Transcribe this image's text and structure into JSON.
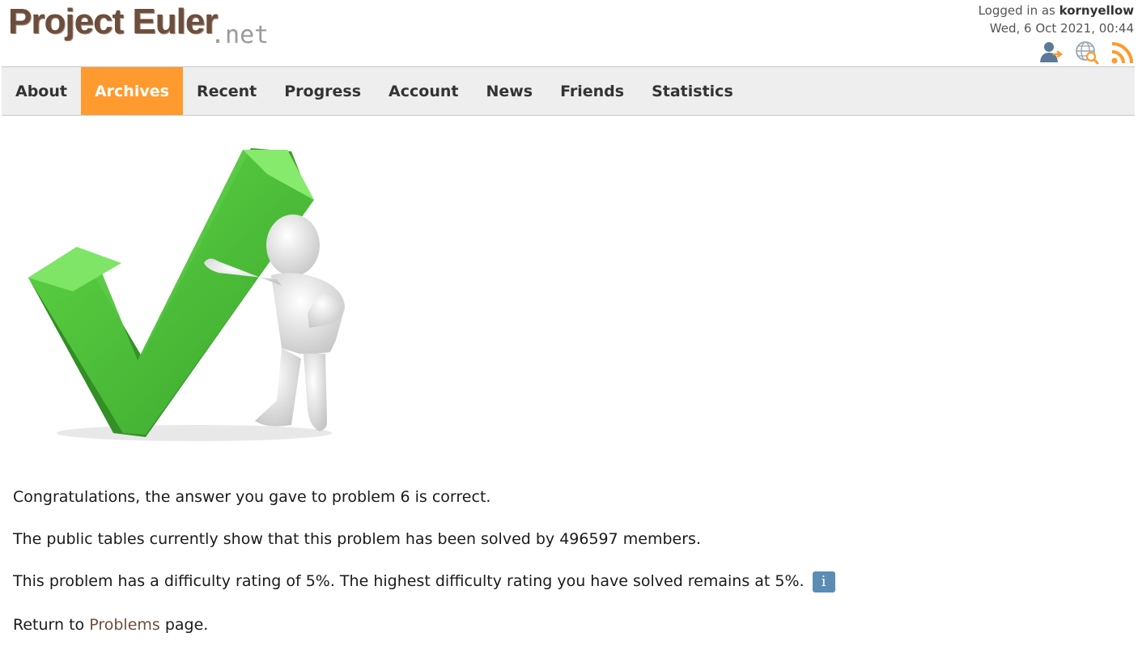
{
  "header": {
    "logo_main": "Project Euler",
    "logo_suffix": ".net",
    "logged_in_prefix": "Logged in as",
    "username": "kornyellow",
    "datetime": "Wed, 6 Oct 2021, 00:44",
    "icons": [
      "user-logout-icon",
      "globe-search-icon",
      "rss-icon"
    ]
  },
  "nav": {
    "items": [
      "About",
      "Archives",
      "Recent",
      "Progress",
      "Account",
      "News",
      "Friends",
      "Statistics"
    ],
    "active": "Archives"
  },
  "main": {
    "congrats": "Congratulations, the answer you gave to problem 6 is correct.",
    "solved_by": "The public tables currently show that this problem has been solved by 496597 members.",
    "difficulty": "This problem has a difficulty rating of 5%. The highest difficulty rating you have solved remains at 5%.",
    "info_icon_glyph": "i",
    "return_prefix": "Return to",
    "return_link": "Problems",
    "return_suffix": "page."
  },
  "colors": {
    "accent": "#ff9a2e",
    "logo_brown": "#6b4e3d",
    "check_green": "#4cc13a",
    "info_blue": "#5b8cb4"
  }
}
